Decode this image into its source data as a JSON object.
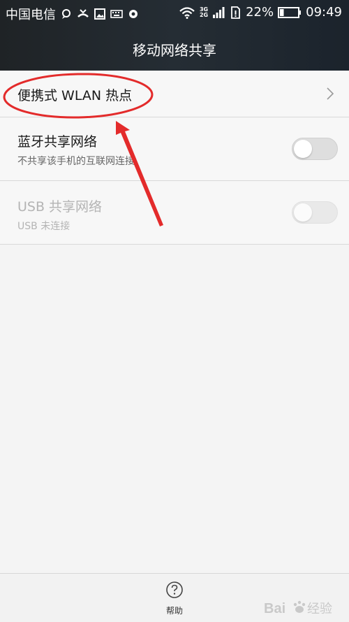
{
  "status_bar": {
    "carrier": "中国电信",
    "network_top": "3G",
    "network_bottom": "2G",
    "battery_percent": "22%",
    "time": "09:49",
    "battery_level": 0.22,
    "icons": [
      "chat-icon",
      "missed-call-icon",
      "image-icon",
      "keyboard-icon",
      "settings-icon",
      "wifi-icon",
      "signal-icon",
      "sim-icon",
      "battery-icon"
    ]
  },
  "header": {
    "title": "移动网络共享"
  },
  "settings": {
    "items": [
      {
        "title": "便携式 WLAN 热点",
        "control": "chevron"
      },
      {
        "title": "蓝牙共享网络",
        "subtitle": "不共享该手机的互联网连接",
        "control": "toggle",
        "enabled": false
      },
      {
        "title": "USB 共享网络",
        "subtitle": "USB 未连接",
        "control": "toggle",
        "enabled": false,
        "disabled": true
      }
    ]
  },
  "bottom_bar": {
    "help_label": "帮助"
  },
  "watermark": {
    "text": "Bai 经验"
  },
  "colors": {
    "header_bg": "#22292f",
    "annotation_red": "#e32b2b",
    "page_bg": "#f4f4f4"
  }
}
